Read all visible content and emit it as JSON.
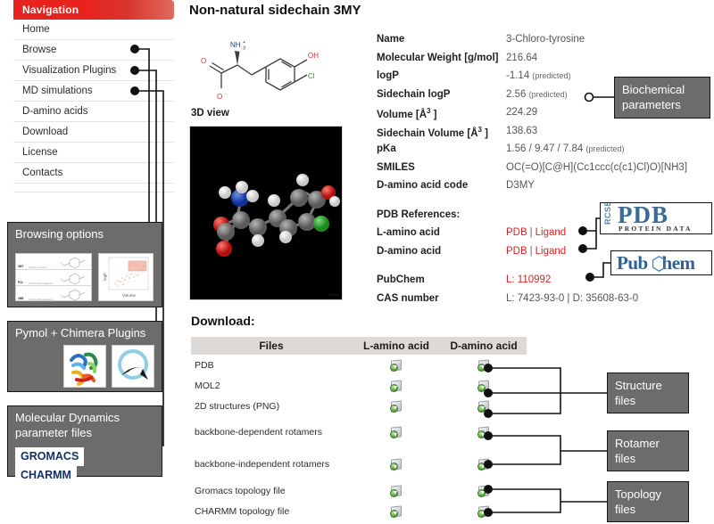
{
  "page": {
    "title": "Non-natural sidechain 3MY",
    "view3d_label": "3D view",
    "view3d_watermark": "JSMol",
    "download_heading": "Download:"
  },
  "navigation": {
    "header": "Navigation",
    "items": [
      {
        "label": "Home"
      },
      {
        "label": "Browse"
      },
      {
        "label": "Visualization Plugins"
      },
      {
        "label": "MD simulations"
      },
      {
        "label": "D-amino acids"
      },
      {
        "label": "Download"
      },
      {
        "label": "License"
      },
      {
        "label": "Contacts"
      }
    ]
  },
  "structure2d": {
    "labels": [
      "NH",
      "3",
      "+",
      "O",
      "O",
      "-",
      "OH",
      "Cl"
    ]
  },
  "properties": [
    {
      "key": "Name",
      "value": "3-Chloro-tyrosine",
      "note": ""
    },
    {
      "key": "Molecular Weight [g/mol]",
      "value": "216.64",
      "note": ""
    },
    {
      "key": "logP",
      "value": "-1.14",
      "note": "(predicted)"
    },
    {
      "key": "Sidechain logP",
      "value": "2.56",
      "note": "(predicted)"
    },
    {
      "key": "Volume [Å3 ]",
      "value": "224.29",
      "note": ""
    },
    {
      "key": "Sidechain Volume [Å3 ]",
      "value": "138.63",
      "note": ""
    },
    {
      "key": "pKa",
      "value": "1.56 / 9.47 / 7.84",
      "note": "(predicted)"
    },
    {
      "key": "SMILES",
      "value": "OC(=O)[C@H](Cc1ccc(c(c1)Cl)O)[NH3]",
      "note": ""
    },
    {
      "key": "D-amino acid code",
      "value": "D3MY",
      "note": ""
    }
  ],
  "property_units": {
    "volume_key_base": "Volume [Å",
    "volume_key_exp": "3",
    "volume_key_tail": " ]",
    "sidechain_volume_key_base": "Sidechain Volume [Å",
    "sidechain_volume_key_exp": "3",
    "sidechain_volume_key_tail": " ]"
  },
  "pdb_references": {
    "heading": "PDB References:",
    "rows": [
      {
        "label": "L-amino acid",
        "link1": "PDB",
        "separator": "|",
        "link2": "Ligand"
      },
      {
        "label": "D-amino acid",
        "link1": "PDB",
        "separator": "|",
        "link2": "Ligand"
      }
    ]
  },
  "external_ids": [
    {
      "key": "PubChem",
      "value": "L: 110992",
      "link": true
    },
    {
      "key": "CAS number",
      "value": "L: 7423-93-0  |  D: 35608-63-0",
      "link": false
    }
  ],
  "logos": {
    "pdb": {
      "rcsb": "RCSB",
      "main": "PDB",
      "sub": "PROTEIN DATA BANK"
    },
    "pubchem": {
      "pre": "Pub",
      "post": "hem"
    }
  },
  "download_table": {
    "columns": [
      "Files",
      "L-amino acid",
      "D-amino acid"
    ],
    "rows": [
      {
        "file": "PDB",
        "l": "download-icon",
        "d": "download-icon"
      },
      {
        "file": "MOL2",
        "l": "download-icon",
        "d": "download-icon"
      },
      {
        "file": "2D structures (PNG)",
        "l": "download-icon",
        "d": "download-icon"
      },
      {
        "file": "backbone-dependent rotamers",
        "l": "download-icon",
        "d": "download-icon"
      },
      {
        "file": "backbone-independent rotamers",
        "l": "download-icon",
        "d": "download-icon"
      },
      {
        "file": "Gromacs topology file",
        "l": "download-icon",
        "d": "download-icon"
      },
      {
        "file": "CHARMM topology file",
        "l": "download-icon",
        "d": "download-icon"
      }
    ]
  },
  "callouts": {
    "biochemical": "Biochemical parameters",
    "browsing": "Browsing options",
    "plugins": "Pymol + Chimera Plugins",
    "md": "Molecular Dynamics parameter files",
    "structure_files": "Structure files",
    "rotamer_files": "Rotamer files",
    "topology_files": "Topology files"
  },
  "md_badges": {
    "gromacs": "GROMACS",
    "charmm": "CHARMM"
  },
  "browse_thumb": {
    "rows": [
      {
        "code": "3MY",
        "text": "3-Chloro-tyrosine"
      },
      {
        "code": "PCL",
        "text": "4-Chloro-Phenylalanine"
      },
      {
        "code": "2BB",
        "text": "2-Bromo-Phenylalanine"
      }
    ],
    "plot": {
      "ylabel": "logP",
      "xlabel": "Volume"
    }
  },
  "colors": {
    "nav_red": "#e8231e",
    "link_red": "#e02020",
    "callout_gray": "#6e6b6b",
    "table_header": "#ddd9d6",
    "pdb_blue": "#3a6a96",
    "pubchem_blue": "#2e5f96"
  }
}
